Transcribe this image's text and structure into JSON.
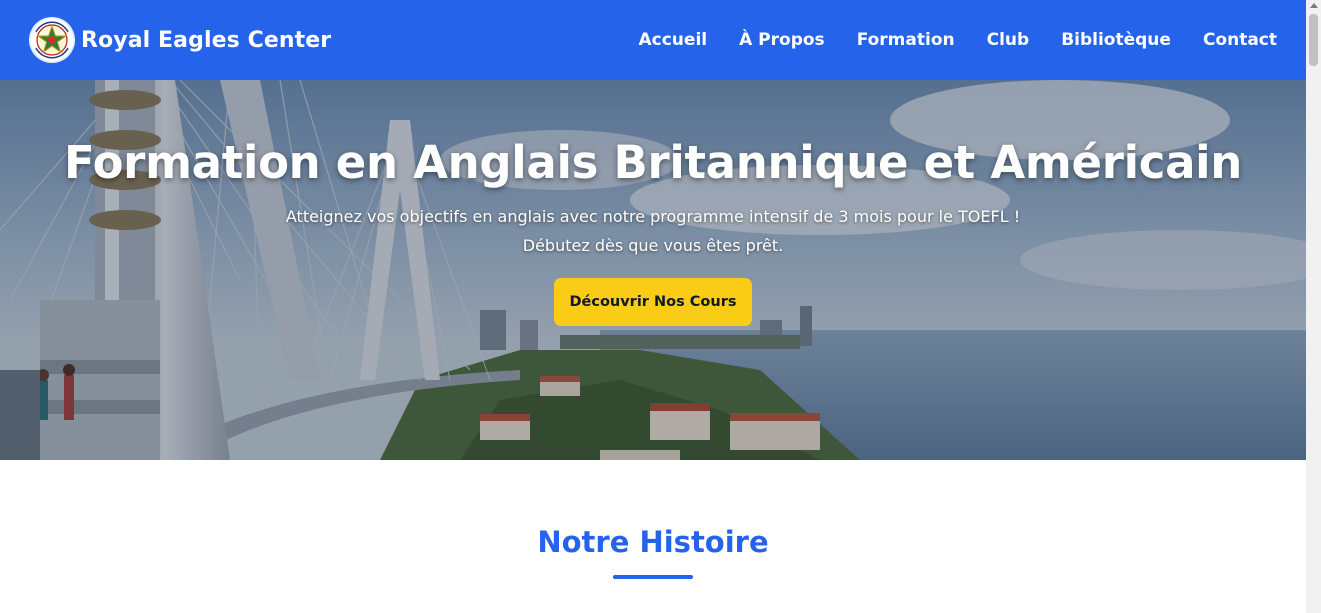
{
  "header": {
    "brand": "Royal Eagles Center",
    "logo_text": "ROYAL EAGLES CENTER",
    "nav": [
      "Accueil",
      "À Propos",
      "Formation",
      "Club",
      "Bibliotèque",
      "Contact"
    ]
  },
  "hero": {
    "title": "Formation en Anglais Britannique et Américain",
    "subtitle_line1": "Atteignez vos objectifs en anglais avec notre programme intensif de 3 mois pour le TOEFL !",
    "subtitle_line2": "Débutez dès que vous êtes prêt.",
    "cta": "Découvrir Nos Cours"
  },
  "section": {
    "title": "Notre Histoire"
  },
  "colors": {
    "primary": "#2563eb",
    "accent": "#facc15",
    "white": "#ffffff"
  }
}
